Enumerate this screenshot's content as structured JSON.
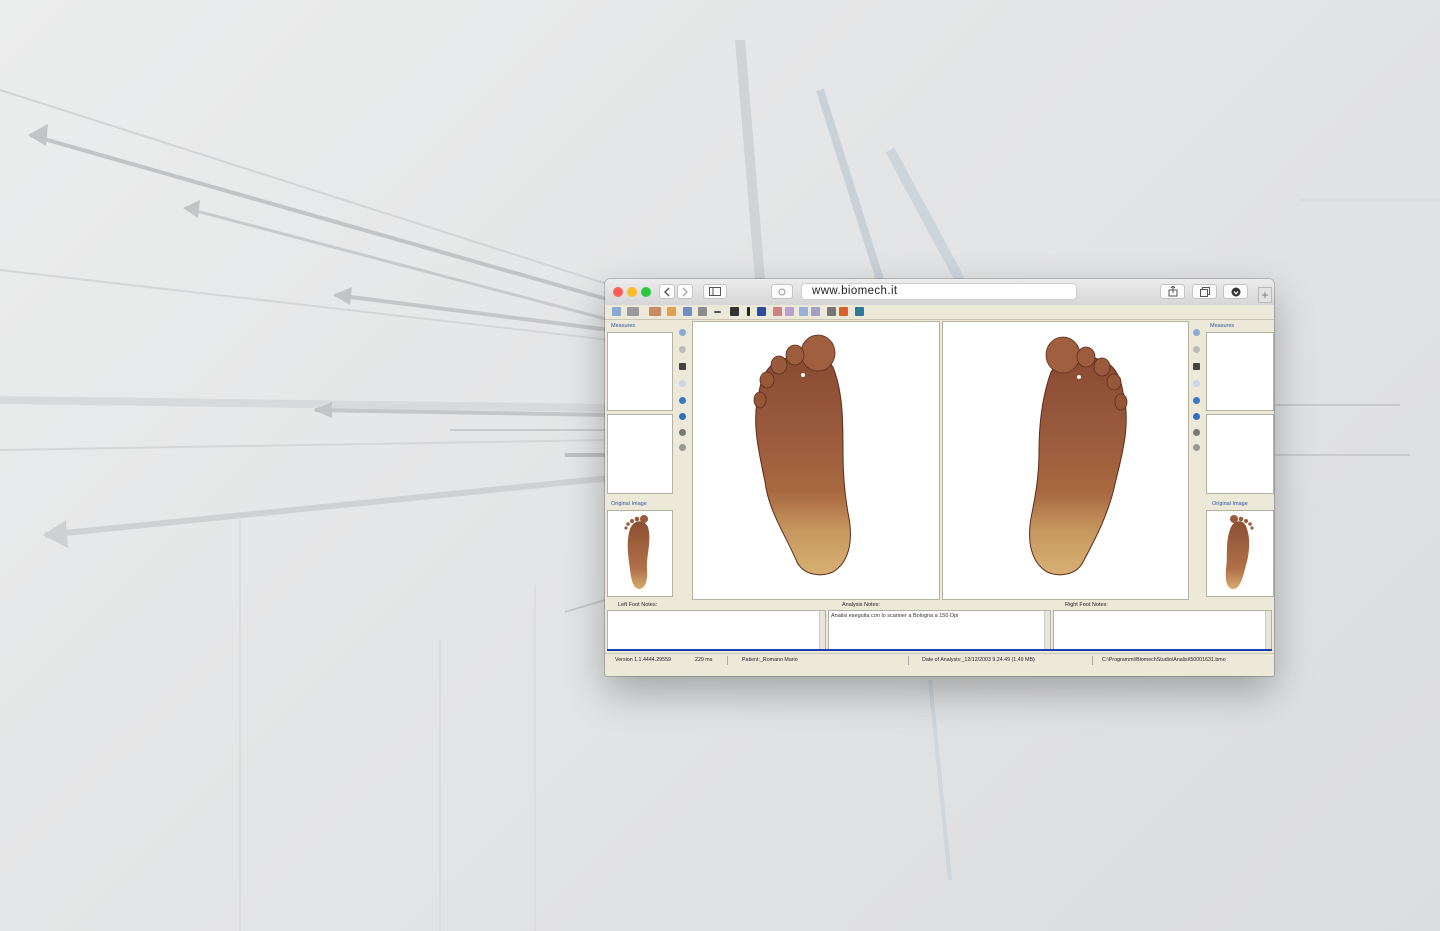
{
  "browser": {
    "url": "www.biomech.it",
    "new_tab_label": "+"
  },
  "app": {
    "left_panel": {
      "measures_label": "Measures",
      "original_image_label": "Original Image"
    },
    "right_panel": {
      "measures_label": "Measures",
      "original_image_label": "Original Image"
    },
    "notes": {
      "left_label": "Left Foot Notes:",
      "analysis_label": "Analysis Notes:",
      "analysis_text": "Analisi eseguita con lo scanner a Bologna a 150 Dpi",
      "right_label": "Right Foot Notes:"
    },
    "status": {
      "version": "Version 1.1.4444.29559",
      "time": "229 ms",
      "patient": "Patient:_Romano Mario",
      "date": "Date of Analysis:_12/12/2003 9.24.49 (1,49 MB)",
      "path": "C:\\Programmi\\BiomechStudio\\Analisi\\50001631.bmo"
    }
  },
  "colors": {
    "accent_blue": "#1c3fb0",
    "app_chrome": "#ece9d8",
    "foot_skin": "#9a5a3c",
    "heel_tone": "#d6ad6f"
  },
  "icons": {
    "close": "red-traffic-light",
    "minimize": "yellow-traffic-light",
    "maximize": "green-traffic-light",
    "back": "chevron-left",
    "forward": "chevron-right",
    "sidebar": "sidebar-icon",
    "share": "share-icon",
    "tabs": "tabs-icon",
    "download": "download-icon"
  }
}
